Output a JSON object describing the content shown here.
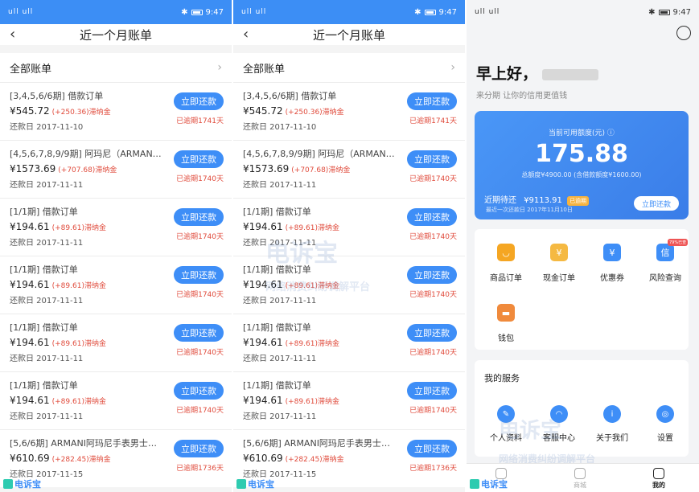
{
  "status": {
    "signal": "ull ull",
    "time": "9:47"
  },
  "bills_screen": {
    "title": "近一个月账单",
    "all_bills": "全部账单",
    "bills": [
      {
        "title": "[3,4,5,6/6期] 借款订单",
        "amount": "¥545.72",
        "fee": "(+250.36)滞纳金",
        "due": "还款日 2017-11-10",
        "button": "立即还款",
        "overdue": "已逾期1741天"
      },
      {
        "title": "[4,5,6,7,8,9/9期] 阿玛尼（ARMANI）...",
        "amount": "¥1573.69",
        "fee": "(+707.68)滞纳金",
        "due": "还款日 2017-11-11",
        "button": "立即还款",
        "overdue": "已逾期1740天"
      },
      {
        "title": "[1/1期] 借款订单",
        "amount": "¥194.61",
        "fee": "(+89.61)滞纳金",
        "due": "还款日 2017-11-11",
        "button": "立即还款",
        "overdue": "已逾期1740天"
      },
      {
        "title": "[1/1期] 借款订单",
        "amount": "¥194.61",
        "fee": "(+89.61)滞纳金",
        "due": "还款日 2017-11-11",
        "button": "立即还款",
        "overdue": "已逾期1740天"
      },
      {
        "title": "[1/1期] 借款订单",
        "amount": "¥194.61",
        "fee": "(+89.61)滞纳金",
        "due": "还款日 2017-11-11",
        "button": "立即还款",
        "overdue": "已逾期1740天"
      },
      {
        "title": "[1/1期] 借款订单",
        "amount": "¥194.61",
        "fee": "(+89.61)滞纳金",
        "due": "还款日 2017-11-11",
        "button": "立即还款",
        "overdue": "已逾期1740天"
      },
      {
        "title": "[5,6/6期] ARMANI阿玛尼手表男士时...",
        "amount": "¥610.69",
        "fee": "(+282.45)滞纳金",
        "due": "还款日 2017-11-15",
        "button": "立即还款",
        "overdue": "已逾期1736天"
      }
    ]
  },
  "home_screen": {
    "greeting": "早上好，",
    "subtitle": "来分期 让你的信用更值钱",
    "credit_label": "当前可用额度(元) ⓘ",
    "credit_amount": "175.88",
    "credit_total": "总额度¥4900.00 (含借款额度¥1600.00)",
    "due_label": "近期待还",
    "due_amount": "¥9113.91",
    "due_tag": "已逾期",
    "due_date": "最近一次还款日 2017年11月10日",
    "pay_button": "立即还款",
    "grid": [
      {
        "label": "商品订单",
        "icon": "shopping-bag-icon",
        "color": "#f5a623"
      },
      {
        "label": "现金订单",
        "icon": "cash-icon",
        "color": "#f5b942"
      },
      {
        "label": "优惠券",
        "icon": "coupon-icon",
        "color": "#3e8ef7"
      },
      {
        "label": "风险查询",
        "icon": "shield-icon",
        "color": "#3e8ef7",
        "badge": "79%已查"
      },
      {
        "label": "钱包",
        "icon": "wallet-icon",
        "color": "#f08a3c"
      }
    ],
    "services_title": "我的服务",
    "services": [
      {
        "label": "个人资料",
        "icon": "profile-icon"
      },
      {
        "label": "客服中心",
        "icon": "headset-icon"
      },
      {
        "label": "关于我们",
        "icon": "info-icon"
      },
      {
        "label": "设置",
        "icon": "settings-icon"
      }
    ],
    "tabs": [
      {
        "label": "",
        "icon": "home-icon"
      },
      {
        "label": "商城",
        "icon": "mall-icon"
      },
      {
        "label": "我的",
        "icon": "mine-icon"
      }
    ]
  },
  "watermark": {
    "small": "电诉宝",
    "big_line1": "电诉宝",
    "big_line2": "网络消费纠纷调解平台"
  }
}
